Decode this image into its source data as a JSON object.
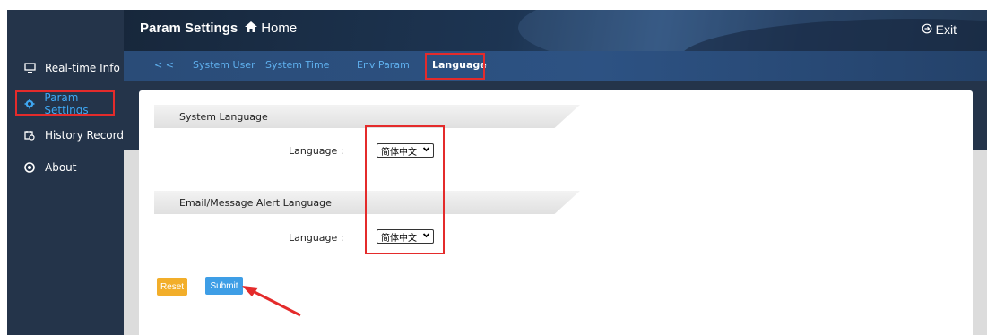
{
  "app": {
    "title": "Param Settings",
    "breadcrumb_home": "Home",
    "exit_label": "Exit"
  },
  "sidebar": {
    "items": [
      {
        "label": "Real-time Info",
        "icon": "monitor-icon"
      },
      {
        "label": "Param Settings",
        "icon": "gear-icon",
        "active": true
      },
      {
        "label": "History Record",
        "icon": "history-icon"
      },
      {
        "label": "About",
        "icon": "info-circle-icon"
      }
    ]
  },
  "tabs": {
    "back": "< <",
    "items": [
      "System User",
      "System Time",
      "Env Param",
      "Language"
    ],
    "active": "Language"
  },
  "sections": {
    "system_language": {
      "title": "System Language",
      "field_label": "Language :",
      "value": "简体中文"
    },
    "alert_language": {
      "title": "Email/Message Alert Language",
      "field_label": "Language :",
      "value": "简体中文"
    }
  },
  "buttons": {
    "reset": "Reset",
    "submit": "Submit"
  },
  "colors": {
    "sidebar_bg": "#24344a",
    "accent_blue": "#3fa7f2",
    "highlight_red": "#e42b2b",
    "reset_orange": "#f2ae2a",
    "submit_blue": "#3e9ee6"
  }
}
